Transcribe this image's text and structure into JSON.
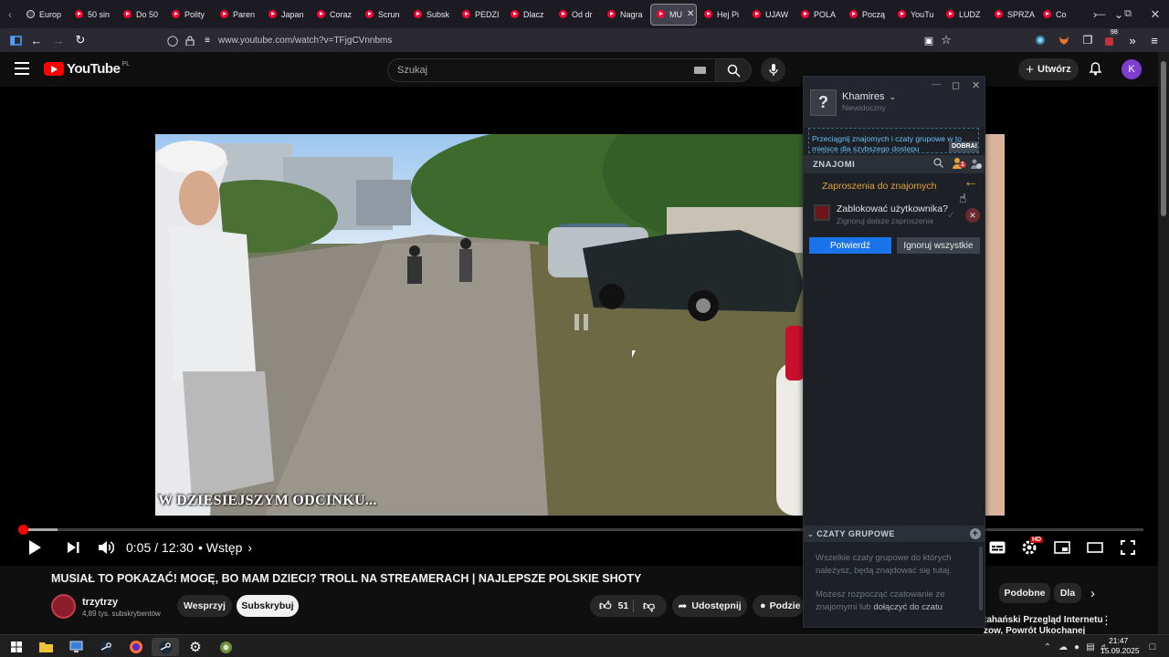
{
  "browser": {
    "tabs": [
      {
        "label": "Europ",
        "type": "globe"
      },
      {
        "label": "50 sin",
        "type": "yt"
      },
      {
        "label": "Do 50",
        "type": "yt"
      },
      {
        "label": "Polity",
        "type": "yt"
      },
      {
        "label": "Paren",
        "type": "yt"
      },
      {
        "label": "Japan",
        "type": "yt"
      },
      {
        "label": "Coraz",
        "type": "yt"
      },
      {
        "label": "Scrun",
        "type": "yt"
      },
      {
        "label": "Subsk",
        "type": "yt"
      },
      {
        "label": "PEDZI",
        "type": "yt"
      },
      {
        "label": "Dlacz",
        "type": "yt"
      },
      {
        "label": "Od dr",
        "type": "yt"
      },
      {
        "label": "Nagra",
        "type": "yt"
      },
      {
        "label": "MU",
        "type": "yt",
        "active": true
      },
      {
        "label": "Hej Pi",
        "type": "yt"
      },
      {
        "label": "UJAW",
        "type": "yt"
      },
      {
        "label": "POLA",
        "type": "yt"
      },
      {
        "label": "Począ",
        "type": "yt"
      },
      {
        "label": "YouTu",
        "type": "yt"
      },
      {
        "label": "LUDZ",
        "type": "yt"
      },
      {
        "label": "SPRZA",
        "type": "yt"
      },
      {
        "label": "Co",
        "type": "yt"
      }
    ],
    "url": "www.youtube.com/watch?v=TFjgCVnnbms",
    "extension_badge": "98"
  },
  "youtube": {
    "logo": "YouTube",
    "region": "PL",
    "search_placeholder": "Szukaj",
    "create_label": "Utwórz",
    "avatar_letter": "K",
    "subtitle": "W DZIESIEJSZYM ODCINKU...",
    "time": "0:05 / 12:30",
    "chapter": "• Wstęp",
    "progress": {
      "played_fraction": 0.004,
      "buffered_fraction": 0.035
    },
    "title": "MUSIAŁ TO POKAZAĆ! MOGĘ, BO MAM DZIECI? TROLL NA STREAMERACH | NAJLEPSZE POLSKIE SHOTY",
    "channel": "trzytrzy",
    "subscribers": "4,89 tys. subskrybentów",
    "support_label": "Wesprzyj",
    "subscribe_label": "Subskrybuj",
    "likes": "51",
    "share_label": "Udostępnij",
    "share_more_label": "Podzie",
    "chips": [
      "Podobne",
      "Dla"
    ],
    "side_video_title": "tahański Przegląd Internetu",
    "side_video_sub": "zow, Powrót Ukochanej",
    "hd_badge": "HD"
  },
  "steam": {
    "username": "Khamires",
    "status": "Niewidoczny",
    "drop_hint": "Przeciągnij znajomych i czaty grupowe w to miejsce dla szybszego dostępu",
    "drop_ok": "DOBRA!",
    "friends_header": "ZNAJOMI",
    "invite_count": "1",
    "invites_label": "Zaproszenia do znajomych",
    "block_question": "Zablokować użytkownika?",
    "block_sub": "Zignoruj dalsze zaproszenia",
    "confirm_label": "Potwierdź",
    "ignore_all_label": "Ignoruj wszystkie",
    "groups_header": "CZATY GRUPOWE",
    "groups_text_1": "Wszelkie czaty grupowe do których należysz, będą znajdować się tutaj.",
    "groups_text_2": "Możesz rozpocząć czatowanie ze znajomymi lub",
    "groups_text_2b": "dołączyć do czatu"
  },
  "taskbar": {
    "time": "21:47",
    "date": "15.09.2025"
  },
  "colors": {
    "yt_red": "#ff0000",
    "steam_blue": "#1a73e8",
    "steam_bg": "#1d2027",
    "invite_orange": "#e2a33b"
  }
}
